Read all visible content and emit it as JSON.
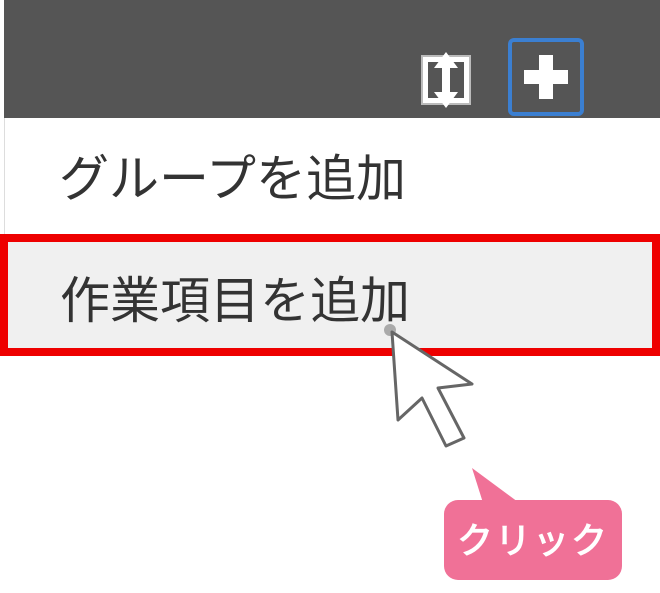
{
  "toolbar": {
    "resize_icon": "vertical-resize-icon",
    "add_icon": "plus-icon",
    "colors": {
      "background": "#555555",
      "add_border": "#3b7fd1"
    }
  },
  "menu": {
    "items": [
      {
        "label": "グループを追加"
      },
      {
        "label": "作業項目を追加",
        "highlighted": true
      }
    ],
    "colors": {
      "highlight_border": "#ee0000",
      "highlight_background": "#f0f0f0"
    }
  },
  "annotation": {
    "cursor_icon": "mouse-pointer-icon",
    "tooltip_label": "クリック",
    "tooltip_color": "#f07197"
  }
}
